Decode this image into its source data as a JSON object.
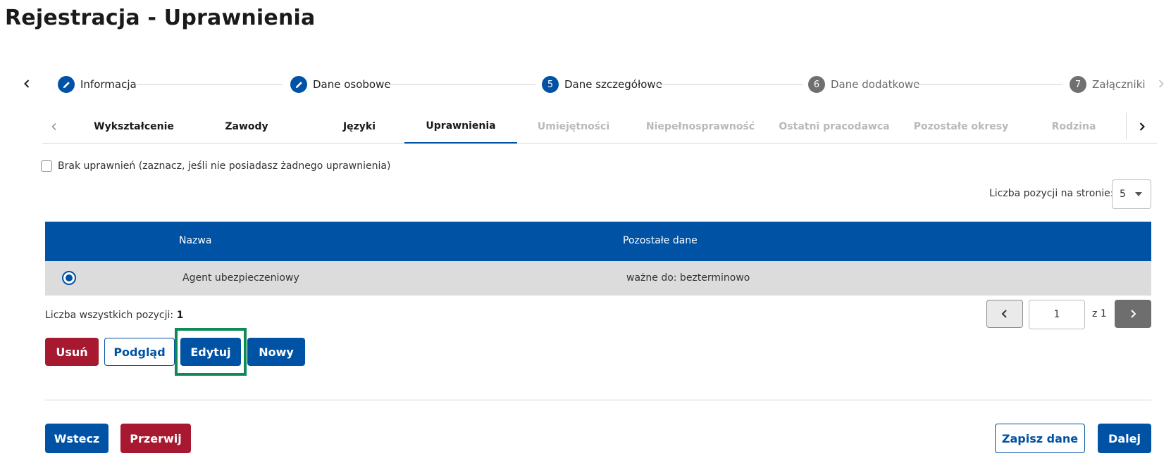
{
  "page": {
    "title": "Rejestracja - Uprawnienia"
  },
  "stepper": {
    "steps": [
      {
        "number": "",
        "label": "Informacja",
        "state": "done"
      },
      {
        "number": "",
        "label": "Dane osobowe",
        "state": "done"
      },
      {
        "number": "5",
        "label": "Dane szczegółowe",
        "state": "active"
      },
      {
        "number": "6",
        "label": "Dane dodatkowe",
        "state": "upcoming"
      },
      {
        "number": "7",
        "label": "Załączniki",
        "state": "upcoming"
      }
    ]
  },
  "tabs": {
    "items": [
      {
        "label": "Wykształcenie",
        "state": "enabled"
      },
      {
        "label": "Zawody",
        "state": "enabled"
      },
      {
        "label": "Języki",
        "state": "enabled"
      },
      {
        "label": "Uprawnienia",
        "state": "active"
      },
      {
        "label": "Umiejętności",
        "state": "disabled"
      },
      {
        "label": "Niepełnosprawność",
        "state": "disabled"
      },
      {
        "label": "Ostatni pracodawca",
        "state": "disabled"
      },
      {
        "label": "Pozostałe okresy",
        "state": "disabled"
      },
      {
        "label": "Rodzina",
        "state": "disabled"
      }
    ]
  },
  "no_privileges": {
    "label": "Brak uprawnień (zaznacz, jeśli nie posiadasz żadnego uprawnienia)",
    "checked": false
  },
  "per_page": {
    "label": "Liczba pozycji na stronie:",
    "value": "5"
  },
  "table": {
    "headers": {
      "name": "Nazwa",
      "other": "Pozostałe dane"
    },
    "rows": [
      {
        "name": "Agent ubezpieczeniowy",
        "other": "ważne do: bezterminowo",
        "selected": true
      }
    ]
  },
  "total": {
    "label": "Liczba wszystkich pozycji:",
    "value": "1"
  },
  "pagination": {
    "current": "1",
    "of_label": "z 1"
  },
  "actions": {
    "delete": "Usuń",
    "preview": "Podgląd",
    "edit": "Edytuj",
    "new": "Nowy"
  },
  "footer": {
    "back": "Wstecz",
    "abort": "Przerwij",
    "save": "Zapisz dane",
    "next": "Dalej"
  },
  "colors": {
    "primary": "#0052a5",
    "danger": "#a71930",
    "highlight": "#0f8a56",
    "row_selected": "#dcdcdc"
  }
}
